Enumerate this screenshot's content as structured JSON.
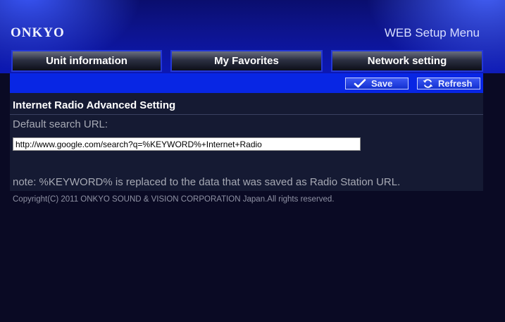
{
  "brand": {
    "logo_text": "ONKYO"
  },
  "header": {
    "title": "WEB Setup Menu"
  },
  "tabs": [
    {
      "label": "Unit information"
    },
    {
      "label": "My Favorites"
    },
    {
      "label": "Network setting"
    }
  ],
  "toolbar": {
    "save_label": "Save",
    "refresh_label": "Refresh"
  },
  "main": {
    "section_title": "Internet Radio Advanced Setting",
    "field_label": "Default search URL:",
    "url_value": "http://www.google.com/search?q=%KEYWORD%+Internet+Radio",
    "note": "note: %KEYWORD% is replaced to the data that was saved as Radio Station URL."
  },
  "footer": {
    "copyright": "Copyright(C) 2011 ONKYO SOUND & VISION CORPORATION Japan.All rights reserved."
  },
  "icons": {
    "save": "check-icon",
    "refresh": "refresh-icon"
  },
  "colors": {
    "accent_blue": "#0826e4",
    "page_background": "#0a0a24",
    "panel_background": "#151a33"
  }
}
